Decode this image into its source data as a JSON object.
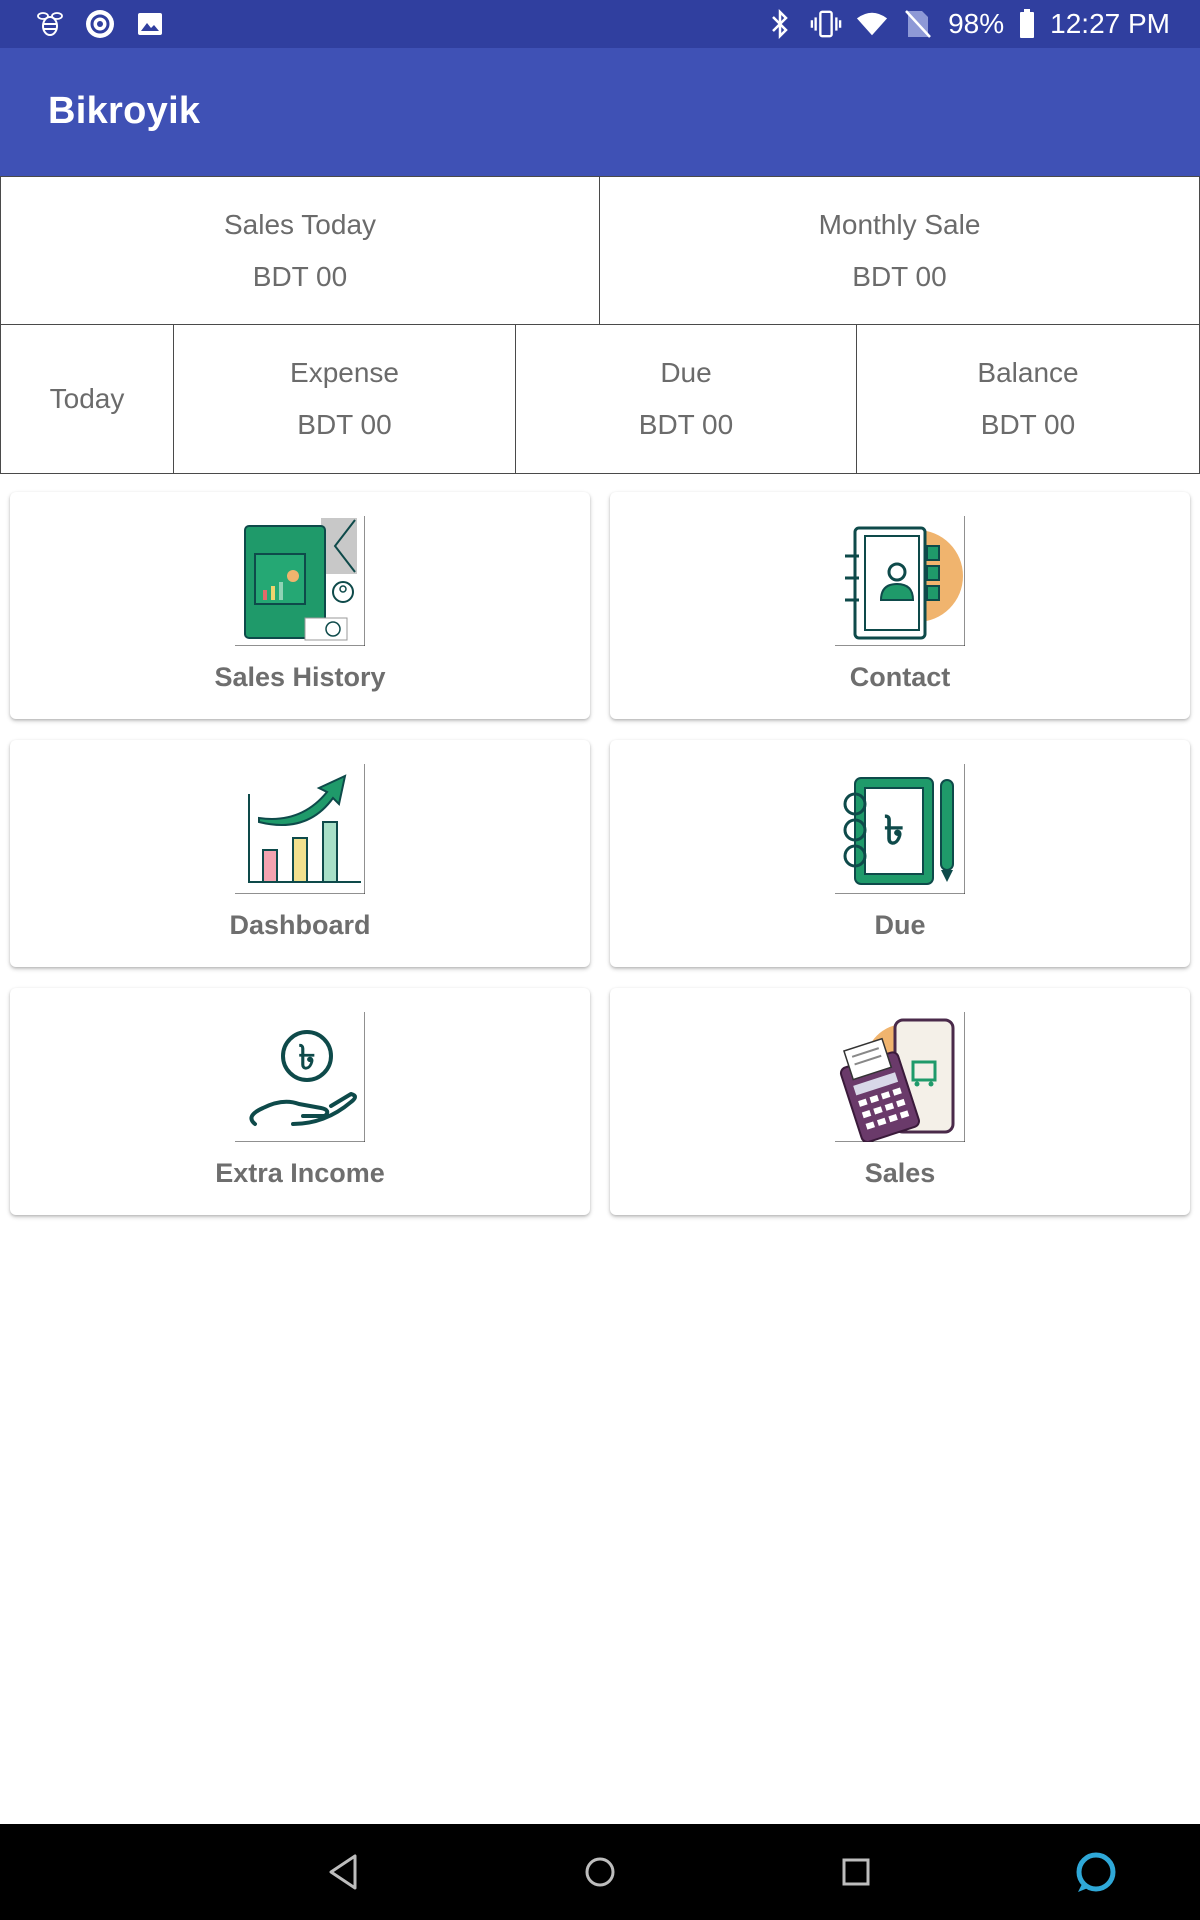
{
  "status_bar": {
    "battery": "98%",
    "time": "12:27 PM",
    "left_icons": [
      "bee-icon",
      "sync-icon",
      "image-icon"
    ],
    "right_icons": [
      "bluetooth-icon",
      "vibrate-icon",
      "wifi-icon",
      "no-sim-icon",
      "battery-icon"
    ]
  },
  "app_bar": {
    "title": "Bikroyik"
  },
  "summary": {
    "sales_today": {
      "label": "Sales Today",
      "value": "BDT 00"
    },
    "monthly_sale": {
      "label": "Monthly Sale",
      "value": "BDT 00"
    },
    "today_label": "Today",
    "expense": {
      "label": "Expense",
      "value": "BDT 00"
    },
    "due": {
      "label": "Due",
      "value": "BDT 00"
    },
    "balance": {
      "label": "Balance",
      "value": "BDT 00"
    }
  },
  "menu": [
    {
      "label": "Sales History",
      "icon": "sales-history-icon"
    },
    {
      "label": "Contact",
      "icon": "contact-book-icon"
    },
    {
      "label": "Dashboard",
      "icon": "dashboard-chart-icon"
    },
    {
      "label": "Due",
      "icon": "due-notebook-icon"
    },
    {
      "label": "Extra Income",
      "icon": "hand-coin-icon"
    },
    {
      "label": "Sales",
      "icon": "pos-terminal-icon"
    }
  ],
  "nav_bar": {
    "buttons": [
      "back-icon",
      "home-icon",
      "recents-icon",
      "assistant-icon"
    ]
  },
  "colors": {
    "status_bar": "#303f9f",
    "app_bar": "#3f51b5",
    "accent_green": "#1f9a6a",
    "dark_teal": "#0e4a4a",
    "orange": "#f0b46e"
  }
}
